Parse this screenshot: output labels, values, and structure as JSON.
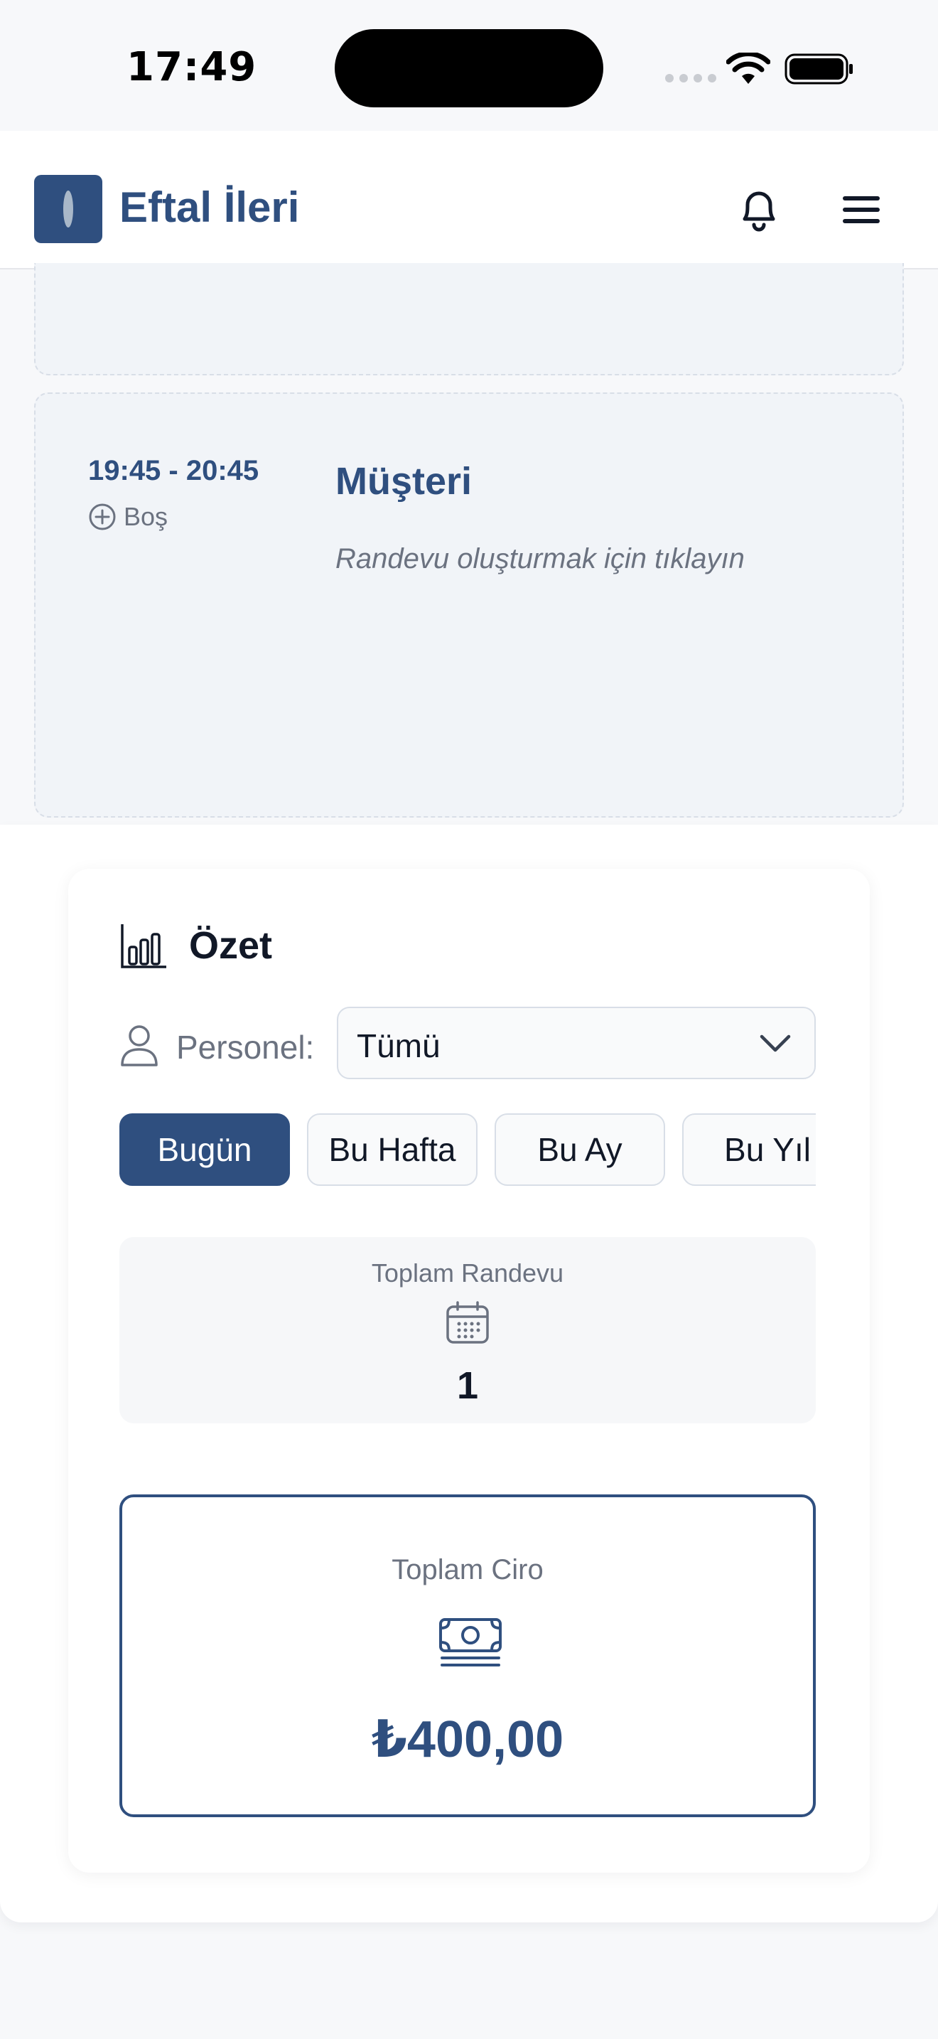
{
  "status_bar": {
    "time": "17:49"
  },
  "header": {
    "brand": "Eftal İleri"
  },
  "slots": [
    {
      "time_range": "19:45 - 20:45",
      "status": "Boş",
      "customer_label": "Müşteri",
      "hint": "Randevu oluşturmak için tıklayın"
    }
  ],
  "summary": {
    "title": "Özet",
    "staff_label": "Personel:",
    "staff_selected": "Tümü",
    "periods": [
      "Bugün",
      "Bu Hafta",
      "Bu Ay",
      "Bu Yıl"
    ],
    "active_period": "Bugün",
    "total_appointments_label": "Toplam Randevu",
    "total_appointments_value": "1",
    "total_revenue_label": "Toplam Ciro",
    "total_revenue_value": "₺400,00"
  },
  "colors": {
    "brand": "#2f4f7f",
    "slot_bg": "#f1f4f8",
    "muted_text": "#6b7280"
  }
}
